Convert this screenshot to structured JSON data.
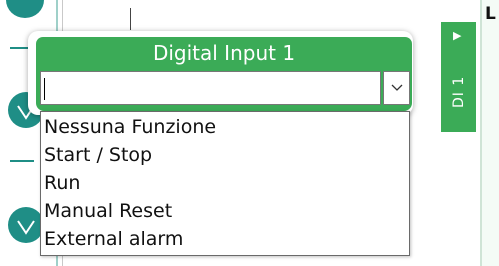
{
  "popup": {
    "title": "Digital Input 1",
    "input_value": "",
    "options": [
      "Nessuna Funzione",
      "Start / Stop",
      "Run",
      "Manual Reset",
      "External alarm"
    ]
  },
  "side_card": {
    "label": "DI 1",
    "arrow": "▶"
  },
  "right_panel": {
    "letter": "L"
  },
  "colors": {
    "header_green": "#3bab57",
    "teal": "#1f8e86"
  },
  "icons": [
    "chevron-down-icon",
    "play-arrow-icon",
    "teal-chevron-icon"
  ]
}
